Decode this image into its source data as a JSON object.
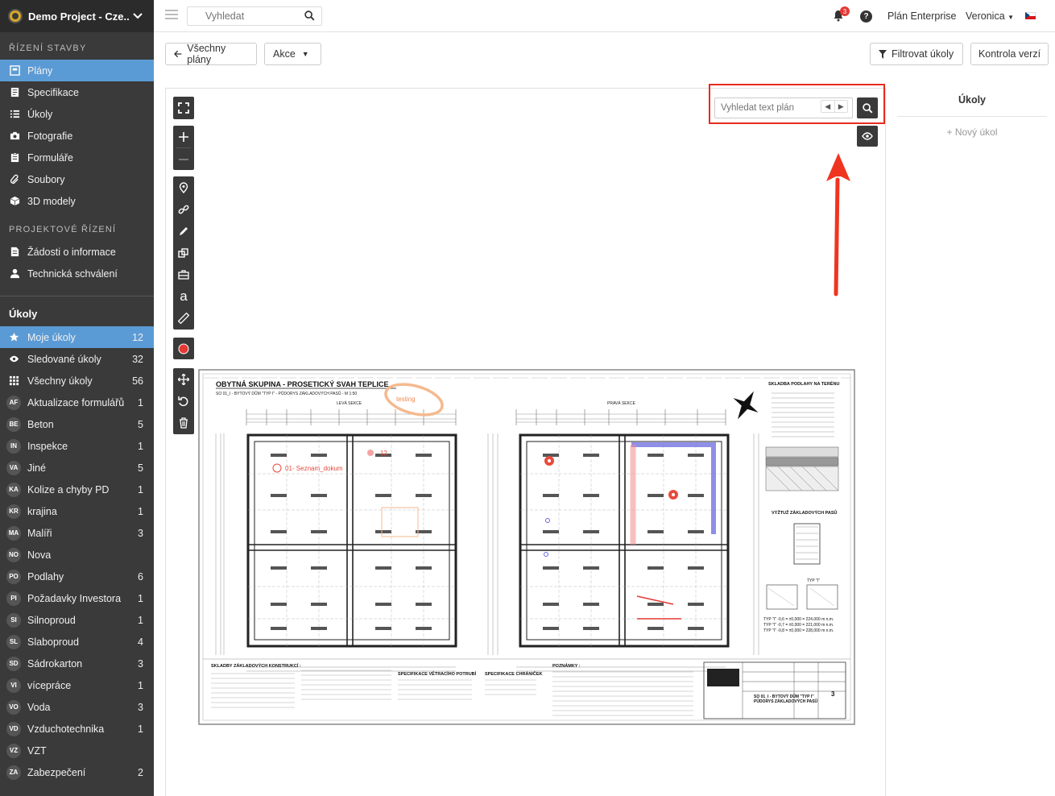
{
  "project": {
    "title": "Demo Project - Cze..."
  },
  "sidebar": {
    "section1": "ŘÍZENÍ STAVBY",
    "nav1": [
      {
        "label": "Plány",
        "icon": "plans-icon",
        "active": true
      },
      {
        "label": "Specifikace",
        "icon": "specs-icon"
      },
      {
        "label": "Úkoly",
        "icon": "list-icon"
      },
      {
        "label": "Fotografie",
        "icon": "camera-icon"
      },
      {
        "label": "Formuláře",
        "icon": "clipboard-icon"
      },
      {
        "label": "Soubory",
        "icon": "paperclip-icon"
      },
      {
        "label": "3D modely",
        "icon": "cube-icon"
      }
    ],
    "section2": "PROJEKTOVÉ ŘÍZENÍ",
    "nav2": [
      {
        "label": "Žádosti o informace",
        "icon": "document-icon"
      },
      {
        "label": "Technická schválení",
        "icon": "user-icon"
      }
    ],
    "tasks_head": "Úkoly",
    "tasks": [
      {
        "badge": "★",
        "label": "Moje úkoly",
        "count": "12",
        "active": true
      },
      {
        "badge": "eye",
        "label": "Sledované úkoly",
        "count": "32"
      },
      {
        "badge": "grid",
        "label": "Všechny úkoly",
        "count": "56"
      },
      {
        "badge": "AF",
        "label": "Aktualizace formulářů",
        "count": "1"
      },
      {
        "badge": "BE",
        "label": "Beton",
        "count": "5"
      },
      {
        "badge": "IN",
        "label": "Inspekce",
        "count": "1"
      },
      {
        "badge": "VA",
        "label": "Jiné",
        "count": "5"
      },
      {
        "badge": "KA",
        "label": "Kolize a chyby PD",
        "count": "1"
      },
      {
        "badge": "KR",
        "label": "krajina",
        "count": "1"
      },
      {
        "badge": "MA",
        "label": "Malíři",
        "count": "3"
      },
      {
        "badge": "NO",
        "label": "Nova",
        "count": ""
      },
      {
        "badge": "PO",
        "label": "Podlahy",
        "count": "6"
      },
      {
        "badge": "PI",
        "label": "Požadavky Investora",
        "count": "1"
      },
      {
        "badge": "SI",
        "label": "Silnoproud",
        "count": "1"
      },
      {
        "badge": "SL",
        "label": "Slaboproud",
        "count": "4"
      },
      {
        "badge": "SD",
        "label": "Sádrokarton",
        "count": "3"
      },
      {
        "badge": "VI",
        "label": "vícepráce",
        "count": "1"
      },
      {
        "badge": "VO",
        "label": "Voda",
        "count": "3"
      },
      {
        "badge": "VD",
        "label": "Vzduchotechnika",
        "count": "1"
      },
      {
        "badge": "VZ",
        "label": "VZT",
        "count": ""
      },
      {
        "badge": "ZA",
        "label": "Zabezpečení",
        "count": "2"
      }
    ]
  },
  "topbar": {
    "search_placeholder": "Vyhledat",
    "notifications": "3",
    "help": "?",
    "plan": "Plán Enterprise",
    "user": "Veronica"
  },
  "toolbar": {
    "back": "Všechny plány",
    "actions": "Akce",
    "filter": "Filtrovat úkoly",
    "version": "Kontrola verzí"
  },
  "viewer": {
    "plan_search_placeholder": "Vyhledat text plán",
    "tool_text": "a"
  },
  "drawing": {
    "title": "OBYTNÁ SKUPINA - PROSETICKÝ SVAH TEPLICE",
    "subtitle": "SO 01_I - BYTOVÝ DŮM \"TYP I\" - PŮDORYS ZÁKLADOVÝCH PASŮ - M 1:50",
    "left_section": "LEVÁ SEKCE",
    "right_section": "PRAVÁ SEKCE",
    "annotation_testing": "testing",
    "annotation_doc": "01- Seznam_dokum",
    "annotation_num": "12",
    "composition_title": "SKLADBA PODLAHY NA TERÉNU",
    "foundation_title": "VÝŽTUŽ ZÁKLADOVÝCH PASŮ",
    "type_label": "TYP \"I\"",
    "bottom1": "SKLADBY ZÁKLADOVÝCH KONSTRUKCÍ :",
    "bottom2": "SPECIFIKACE VĚTRACÍHO POTRUBÍ",
    "bottom3": "SPECIFIKACE CHRÁNIČEK",
    "bottom4": "POZNÁMKY :",
    "stamp_title": "SO 01_I - BYTOVÝ DŮM \"TYP I\"",
    "stamp_sub": "PŮDORYS ZÁKLADOVÝCH PASŮ",
    "stamp_num": "3",
    "types": [
      "TYP \"I\" -0,6 = ±0,000 = 224,000 m n.m.",
      "TYP \"I\" -0,7 = ±0,000 = 221,000 m n.m.",
      "TYP \"I\" -0,8 = ±0,000 = 228,000 m n.m."
    ]
  },
  "right_panel": {
    "title": "Úkoly",
    "new_task": "+ Nový úkol"
  },
  "colors": {
    "sidebar_bg": "#3a3a3a",
    "active": "#5b9bd5",
    "highlight": "#e82b1e"
  }
}
